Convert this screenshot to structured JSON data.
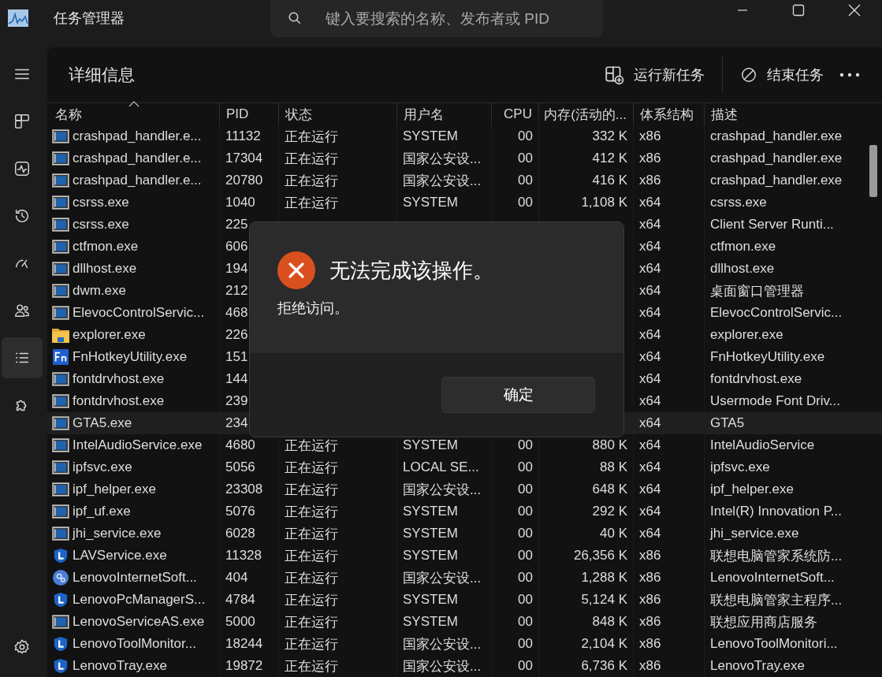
{
  "window": {
    "title": "任务管理器"
  },
  "search": {
    "placeholder": "键入要搜索的名称、发布者或 PID"
  },
  "sidebar": {
    "items": [
      {
        "kind": "processes",
        "selected": false
      },
      {
        "kind": "performance",
        "selected": false
      },
      {
        "kind": "history",
        "selected": false
      },
      {
        "kind": "startup",
        "selected": false
      },
      {
        "kind": "users",
        "selected": false
      },
      {
        "kind": "details",
        "selected": true
      },
      {
        "kind": "services",
        "selected": false
      }
    ]
  },
  "page": {
    "title": "详细信息"
  },
  "toolbar": {
    "run_task": "运行新任务",
    "end_task": "结束任务"
  },
  "table": {
    "columns": [
      {
        "label": "名称",
        "sorted": true
      },
      {
        "label": "PID",
        "sorted": false
      },
      {
        "label": "状态",
        "sorted": false
      },
      {
        "label": "用户名",
        "sorted": false
      },
      {
        "label": "CPU",
        "sorted": false
      },
      {
        "label": "内存(活动的...",
        "sorted": false
      },
      {
        "label": "体系结构",
        "sorted": false
      },
      {
        "label": "描述",
        "sorted": false
      }
    ],
    "rows": [
      {
        "kind": "app",
        "name": "crashpad_handler.e...",
        "pid": "11132",
        "status": "正在运行",
        "user": "SYSTEM",
        "cpu": "00",
        "memory": "332 K",
        "arch": "x86",
        "description": "crashpad_handler.exe",
        "selected": false
      },
      {
        "kind": "app",
        "name": "crashpad_handler.e...",
        "pid": "17304",
        "status": "正在运行",
        "user": "国家公安设...",
        "cpu": "00",
        "memory": "412 K",
        "arch": "x86",
        "description": "crashpad_handler.exe",
        "selected": false
      },
      {
        "kind": "app",
        "name": "crashpad_handler.e...",
        "pid": "20780",
        "status": "正在运行",
        "user": "国家公安设...",
        "cpu": "00",
        "memory": "416 K",
        "arch": "x86",
        "description": "crashpad_handler.exe",
        "selected": false
      },
      {
        "kind": "app",
        "name": "csrss.exe",
        "pid": "1040",
        "status": "正在运行",
        "user": "SYSTEM",
        "cpu": "00",
        "memory": "1,108 K",
        "arch": "x64",
        "description": "csrss.exe",
        "selected": false
      },
      {
        "kind": "app",
        "name": "csrss.exe",
        "pid": "225",
        "arch": "x64",
        "description": "Client Server Runti...",
        "selected": false
      },
      {
        "kind": "app",
        "name": "ctfmon.exe",
        "pid": "606",
        "arch": "x64",
        "description": "ctfmon.exe",
        "selected": false
      },
      {
        "kind": "app",
        "name": "dllhost.exe",
        "pid": "194",
        "arch": "x64",
        "description": "dllhost.exe",
        "selected": false
      },
      {
        "kind": "app",
        "name": "dwm.exe",
        "pid": "212",
        "arch": "x64",
        "description": "桌面窗口管理器",
        "selected": false
      },
      {
        "kind": "app",
        "name": "ElevocControlServic...",
        "pid": "468",
        "arch": "x64",
        "description": "ElevocControlServic...",
        "selected": false
      },
      {
        "kind": "folder",
        "name": "explorer.exe",
        "pid": "226",
        "arch": "x64",
        "description": "explorer.exe",
        "selected": false
      },
      {
        "kind": "fn",
        "name": "FnHotkeyUtility.exe",
        "pid": "151",
        "arch": "x64",
        "description": "FnHotkeyUtility.exe",
        "selected": false
      },
      {
        "kind": "app",
        "name": "fontdrvhost.exe",
        "pid": "144",
        "arch": "x64",
        "description": "fontdrvhost.exe",
        "selected": false
      },
      {
        "kind": "app",
        "name": "fontdrvhost.exe",
        "pid": "239",
        "arch": "x64",
        "description": "Usermode Font Driv...",
        "selected": false
      },
      {
        "kind": "app",
        "name": "GTA5.exe",
        "pid": "234",
        "arch": "x64",
        "description": "GTA5",
        "selected": true
      },
      {
        "kind": "app",
        "name": "IntelAudioService.exe",
        "pid": "4680",
        "status": "正在运行",
        "user": "SYSTEM",
        "cpu": "00",
        "memory": "880 K",
        "arch": "x64",
        "description": "IntelAudioService",
        "selected": false
      },
      {
        "kind": "app",
        "name": "ipfsvc.exe",
        "pid": "5056",
        "status": "正在运行",
        "user": "LOCAL SE...",
        "cpu": "00",
        "memory": "88 K",
        "arch": "x64",
        "description": "ipfsvc.exe",
        "selected": false
      },
      {
        "kind": "app",
        "name": "ipf_helper.exe",
        "pid": "23308",
        "status": "正在运行",
        "user": "国家公安设...",
        "cpu": "00",
        "memory": "648 K",
        "arch": "x64",
        "description": "ipf_helper.exe",
        "selected": false
      },
      {
        "kind": "app",
        "name": "ipf_uf.exe",
        "pid": "5076",
        "status": "正在运行",
        "user": "SYSTEM",
        "cpu": "00",
        "memory": "292 K",
        "arch": "x64",
        "description": "Intel(R) Innovation P...",
        "selected": false
      },
      {
        "kind": "app",
        "name": "jhi_service.exe",
        "pid": "6028",
        "status": "正在运行",
        "user": "SYSTEM",
        "cpu": "00",
        "memory": "40 K",
        "arch": "x64",
        "description": "jhi_service.exe",
        "selected": false
      },
      {
        "kind": "shield",
        "name": "LAVService.exe",
        "pid": "11328",
        "status": "正在运行",
        "user": "SYSTEM",
        "cpu": "00",
        "memory": "26,356 K",
        "arch": "x86",
        "description": "联想电脑管家系统防...",
        "selected": false
      },
      {
        "kind": "gears",
        "name": "LenovoInternetSoft...",
        "pid": "404",
        "status": "正在运行",
        "user": "国家公安设...",
        "cpu": "00",
        "memory": "1,288 K",
        "arch": "x86",
        "description": "LenovoInternetSoft...",
        "selected": false
      },
      {
        "kind": "shield",
        "name": "LenovoPcManagerS...",
        "pid": "4784",
        "status": "正在运行",
        "user": "SYSTEM",
        "cpu": "00",
        "memory": "5,124 K",
        "arch": "x86",
        "description": "联想电脑管家主程序...",
        "selected": false
      },
      {
        "kind": "app",
        "name": "LenovoServiceAS.exe",
        "pid": "5000",
        "status": "正在运行",
        "user": "SYSTEM",
        "cpu": "00",
        "memory": "848 K",
        "arch": "x86",
        "description": "联想应用商店服务",
        "selected": false
      },
      {
        "kind": "shield",
        "name": "LenovoToolMonitor...",
        "pid": "18244",
        "status": "正在运行",
        "user": "国家公安设...",
        "cpu": "00",
        "memory": "2,104 K",
        "arch": "x86",
        "description": "LenovoToolMonitori...",
        "selected": false
      },
      {
        "kind": "shield",
        "name": "LenovoTray.exe",
        "pid": "19872",
        "status": "正在运行",
        "user": "国家公安设...",
        "cpu": "00",
        "memory": "6,736 K",
        "arch": "x86",
        "description": "LenovoTray.exe",
        "selected": false
      }
    ]
  },
  "dialog": {
    "title": "无法完成该操作。",
    "message": "拒绝访问。",
    "button": "确定"
  }
}
